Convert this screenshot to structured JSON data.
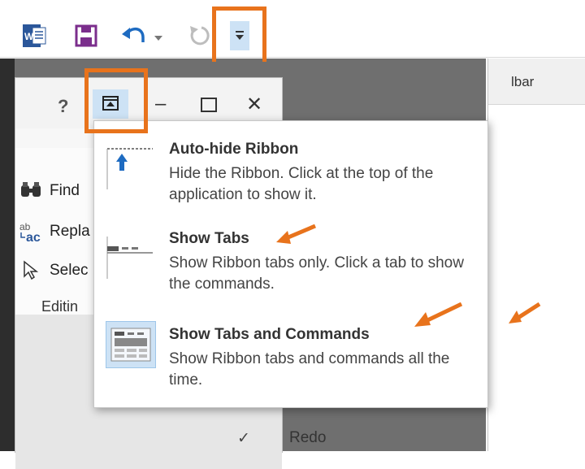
{
  "qat": {
    "icons": [
      "word-icon",
      "save-icon",
      "undo-icon",
      "dropdown-arrow-icon",
      "repeat-icon",
      "customize-qat-icon"
    ],
    "colors": {
      "word": "#2b579a",
      "save": "#7b2e8c",
      "undo": "#1e6bc1",
      "accent": "#cde2f5"
    }
  },
  "window": {
    "help_label": "?",
    "minimize_label": "–",
    "close_label": "✕",
    "editing": {
      "find_label": "Find",
      "replace_label": "Repla",
      "select_label": "Selec",
      "group_label": "Editin"
    }
  },
  "menu": {
    "header_text": "lbar",
    "redo_label": "Redo",
    "check_glyph": "✓"
  },
  "ribbon_display_options": [
    {
      "title": "Auto-hide Ribbon",
      "desc": "Hide the Ribbon. Click at the top of the application to show it.",
      "icon": "auto-hide-ribbon-icon",
      "selected": false
    },
    {
      "title": "Show Tabs",
      "desc": "Show Ribbon tabs only. Click a tab to show the commands.",
      "icon": "show-tabs-icon",
      "selected": false
    },
    {
      "title": "Show Tabs and Commands",
      "desc": "Show Ribbon tabs and commands all the time.",
      "icon": "show-tabs-commands-icon",
      "selected": true
    }
  ],
  "annotation_color": "#e8731c"
}
